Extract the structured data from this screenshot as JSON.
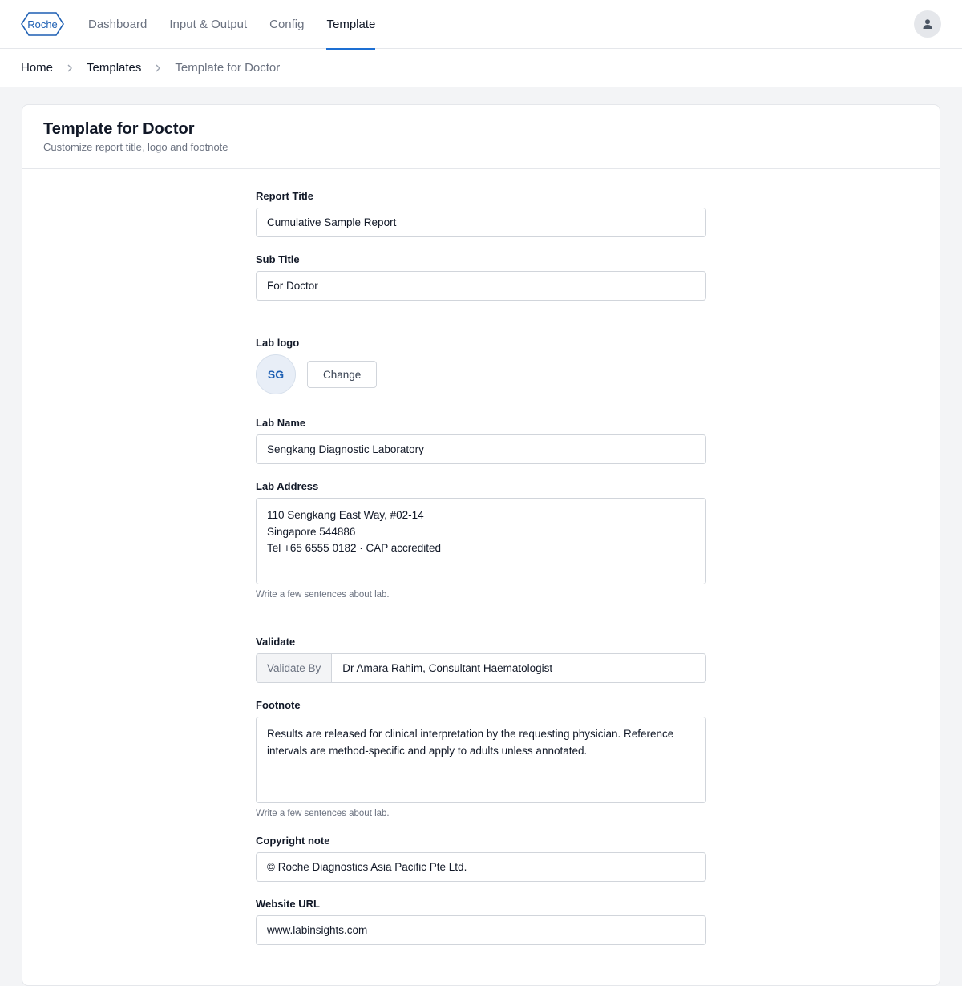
{
  "brand": {
    "logo_text": "Roche",
    "accent": "#1d6fd3"
  },
  "nav": {
    "items": [
      {
        "label": "Dashboard",
        "active": false
      },
      {
        "label": "Input & Output",
        "active": false
      },
      {
        "label": "Config",
        "active": false
      },
      {
        "label": "Template",
        "active": true
      }
    ],
    "user_icon": "user-icon"
  },
  "breadcrumb": {
    "items": [
      "Home",
      "Templates",
      "Template for Doctor"
    ]
  },
  "page": {
    "title": "Template for Doctor",
    "subtitle": "Customize report title, logo and footnote"
  },
  "form": {
    "report_title": {
      "label": "Report Title",
      "value": "Cumulative Sample Report"
    },
    "sub_title": {
      "label": "Sub Title",
      "value": "For Doctor"
    },
    "lab_logo": {
      "label": "Lab logo",
      "initials": "SG",
      "change_label": "Change"
    },
    "lab_name": {
      "label": "Lab Name",
      "value": "Sengkang Diagnostic Laboratory"
    },
    "lab_address": {
      "label": "Lab Address",
      "value": "110 Sengkang East Way, #02-14\nSingapore 544886\nTel +65 6555 0182 · CAP accredited",
      "help": "Write a few sentences about lab."
    },
    "validate": {
      "label": "Validate",
      "prefix": "Validate By",
      "value": "Dr Amara Rahim, Consultant Haematologist"
    },
    "footnote": {
      "label": "Footnote",
      "value": "Results are released for clinical interpretation by the requesting physician. Reference intervals are method-specific and apply to adults unless annotated.",
      "help": "Write a few sentences about lab."
    },
    "copyright": {
      "label": "Copyright note",
      "value": "© Roche Diagnostics Asia Pacific Pte Ltd."
    },
    "website": {
      "label": "Website URL",
      "value": "www.labinsights.com"
    }
  }
}
